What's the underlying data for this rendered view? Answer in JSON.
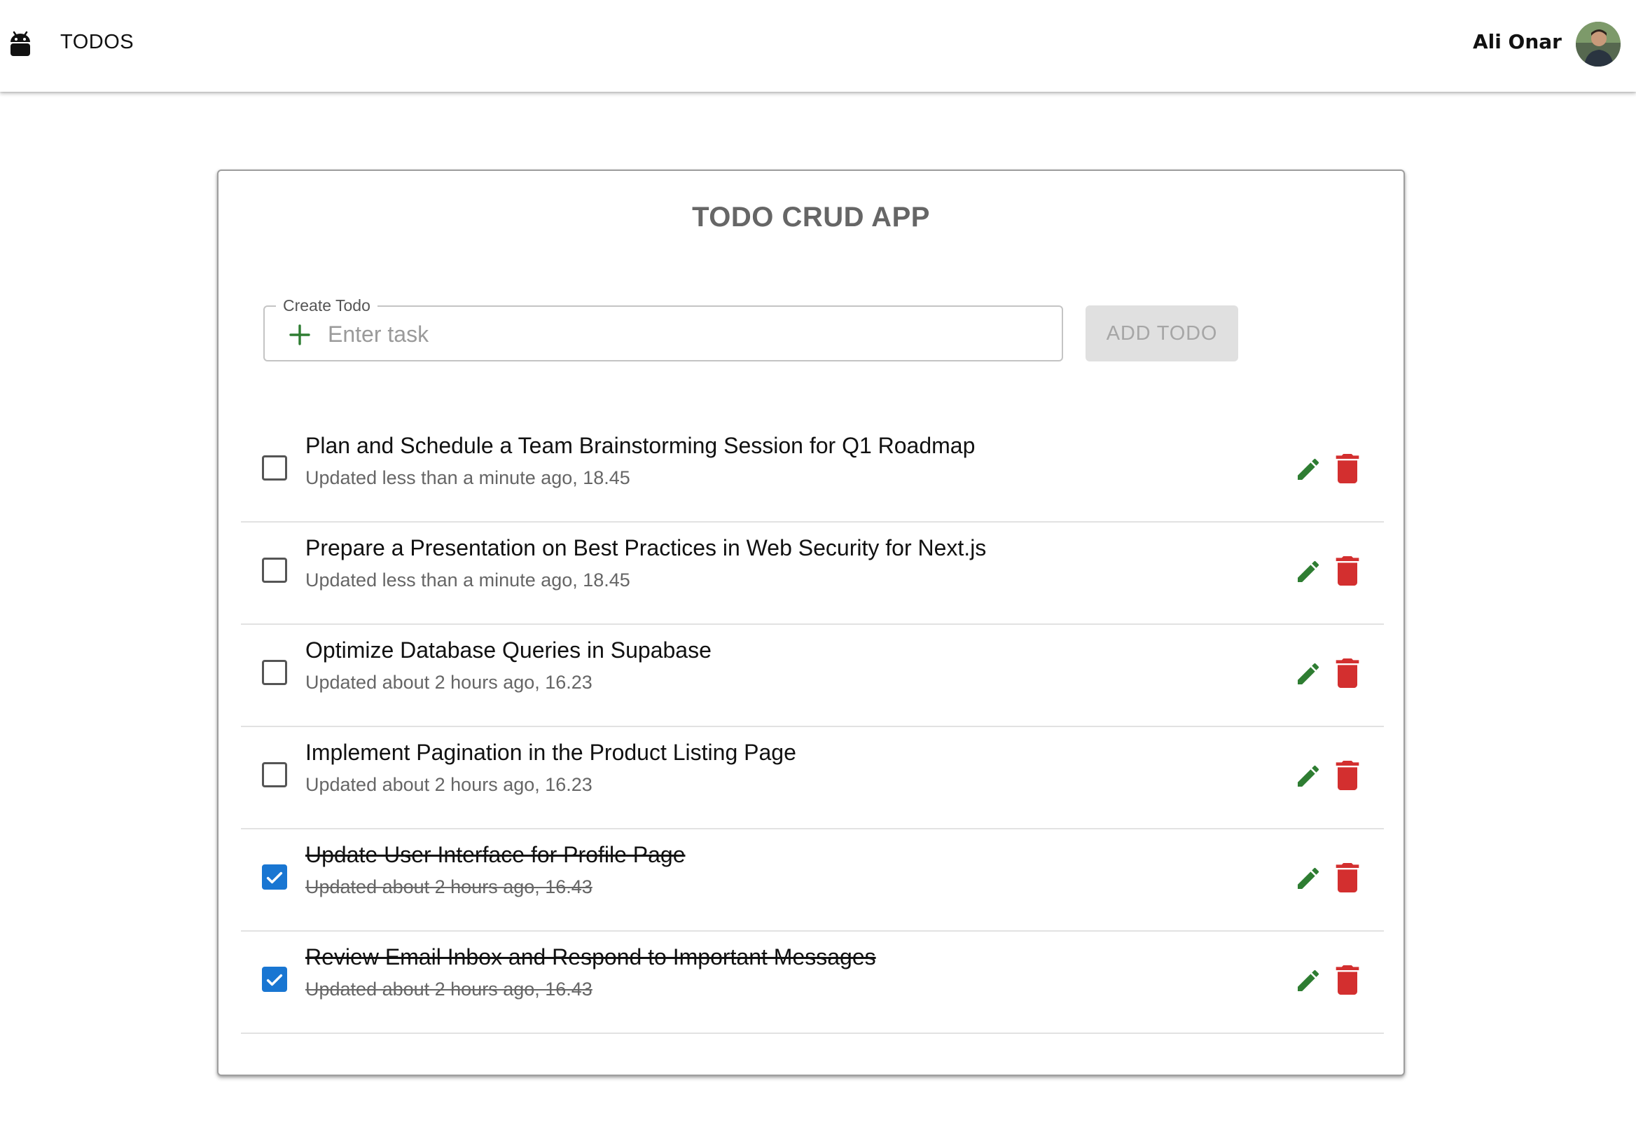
{
  "appbar": {
    "brand_icon": "android-icon",
    "title": "TODOS",
    "user_name": "Ali Onar"
  },
  "card": {
    "title": "TODO CRUD APP",
    "input": {
      "label": "Create Todo",
      "placeholder": "Enter task",
      "value": "",
      "icon": "plus-icon"
    },
    "add_button": "ADD TODO"
  },
  "todos": [
    {
      "title": "Plan and Schedule a Team Brainstorming Session for Q1 Roadmap",
      "meta": "Updated less than a minute ago, 18.45",
      "completed": false
    },
    {
      "title": "Prepare a Presentation on Best Practices in Web Security for Next.js",
      "meta": "Updated less than a minute ago, 18.45",
      "completed": false
    },
    {
      "title": "Optimize Database Queries in Supabase",
      "meta": "Updated about 2 hours ago, 16.23",
      "completed": false
    },
    {
      "title": "Implement Pagination in the Product Listing Page",
      "meta": "Updated about 2 hours ago, 16.23",
      "completed": false
    },
    {
      "title": "Update User Interface for Profile Page",
      "meta": "Updated about 2 hours ago, 16.43",
      "completed": true
    },
    {
      "title": "Review Email Inbox and Respond to Important Messages",
      "meta": "Updated about 2 hours ago, 16.43",
      "completed": true
    }
  ],
  "colors": {
    "edit": "#2e7d32",
    "delete": "#d32f2f",
    "checked": "#1976d2",
    "add_plus": "#2e7d32"
  },
  "icons": {
    "edit": "pencil-icon",
    "delete": "trash-icon",
    "checked": "check-icon"
  }
}
